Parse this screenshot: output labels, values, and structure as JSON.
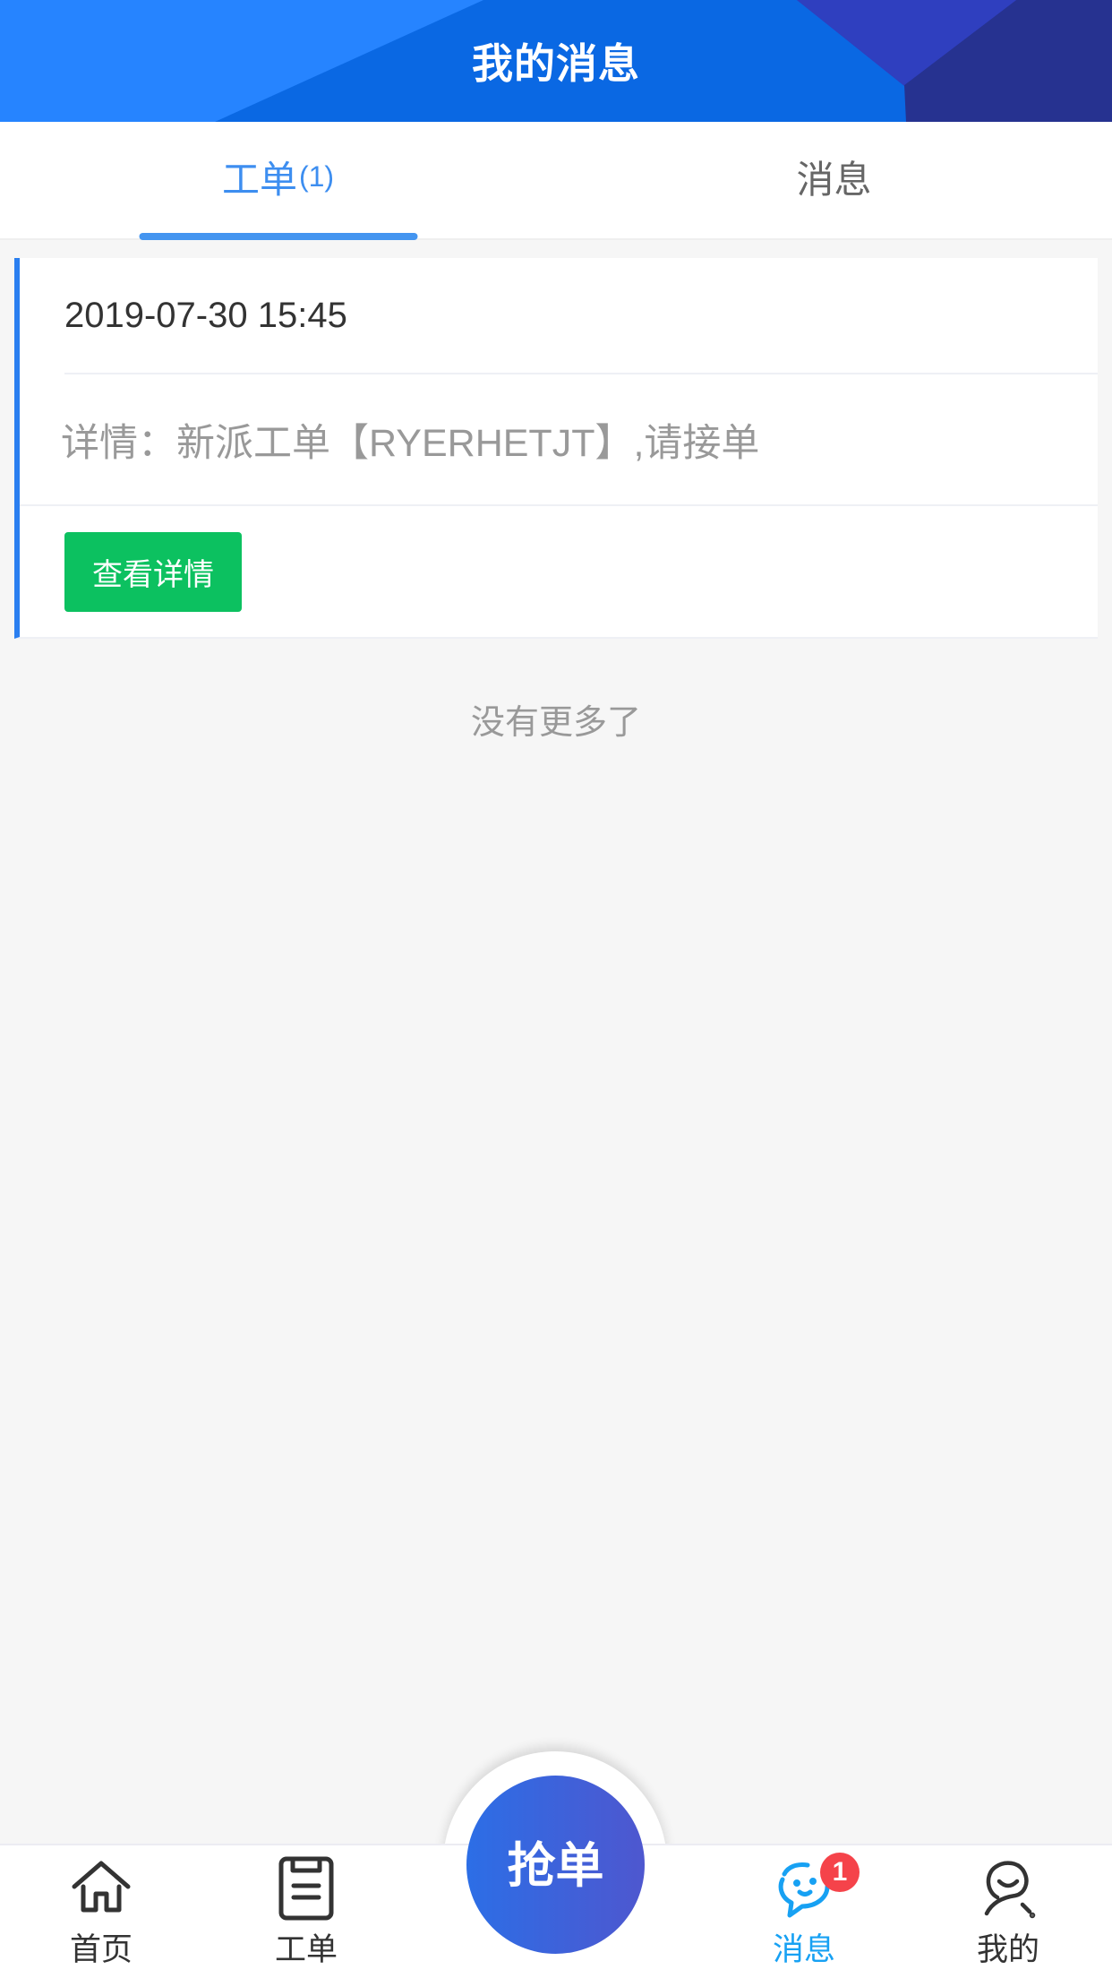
{
  "header": {
    "title": "我的消息"
  },
  "tabs": [
    {
      "label": "工单",
      "count": "(1)",
      "active": true
    },
    {
      "label": "消息",
      "count": "",
      "active": false
    }
  ],
  "messages": [
    {
      "time": "2019-07-30 15:45",
      "detail": "详情：新派工单【RYERHETJT】,请接单",
      "action_label": "查看详情"
    }
  ],
  "list_end_text": "没有更多了",
  "bottom_nav": {
    "items": [
      {
        "label": "首页",
        "icon": "home-icon",
        "active": false
      },
      {
        "label": "工单",
        "icon": "clipboard-icon",
        "active": false
      },
      {
        "label": "消息",
        "icon": "chat-bubble-icon",
        "active": true,
        "badge": "1"
      },
      {
        "label": "我的",
        "icon": "user-icon",
        "active": false
      }
    ],
    "fab_label": "抢单"
  },
  "colors": {
    "primary_blue": "#2684ff",
    "tab_active": "#3d8ef0",
    "button_green": "#0cc160",
    "nav_active": "#17a1f3",
    "badge_red": "#f5434a"
  }
}
